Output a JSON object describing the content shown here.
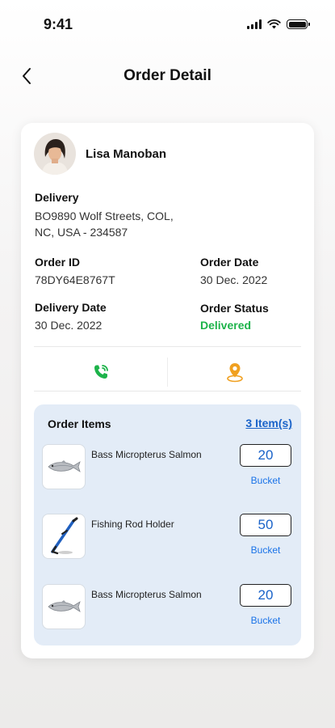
{
  "status_bar": {
    "time": "9:41"
  },
  "header": {
    "title": "Order Detail"
  },
  "customer": {
    "name": "Lisa Manoban"
  },
  "delivery": {
    "label": "Delivery",
    "address_line1": "BO9890 Wolf Streets, COL,",
    "address_line2": "NC, USA - 234587"
  },
  "order": {
    "id_label": "Order ID",
    "id_value": "78DY64E8767T",
    "date_label": "Order Date",
    "date_value": "30 Dec. 2022",
    "delivery_date_label": "Delivery Date",
    "delivery_date_value": "30 Dec. 2022",
    "status_label": "Order Status",
    "status_value": "Delivered"
  },
  "colors": {
    "status_green": "#1db34a",
    "accent_blue": "#1a63c9",
    "call_icon": "#1db34a",
    "location_icon": "#f0a020",
    "items_panel_bg": "#e3ecf7"
  },
  "actions": [
    {
      "icon": "phone-call-icon"
    },
    {
      "icon": "location-pin-icon"
    }
  ],
  "order_items": {
    "title": "Order Items",
    "count_label": "3 Item(s)",
    "items": [
      {
        "name": "Bass Micropterus Salmon",
        "quantity": "20",
        "unit": "Bucket",
        "icon": "fish-image"
      },
      {
        "name": "Fishing Rod Holder",
        "quantity": "50",
        "unit": "Bucket",
        "icon": "rod-holder-image"
      },
      {
        "name": "Bass Micropterus Salmon",
        "quantity": "20",
        "unit": "Bucket",
        "icon": "fish-image"
      }
    ]
  }
}
